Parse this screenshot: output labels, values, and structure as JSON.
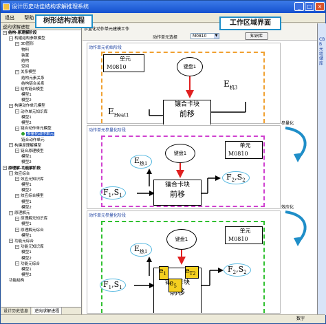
{
  "window": {
    "title": "设计历史动佳结构求解推理系统"
  },
  "menu": [
    "退出",
    "帮助"
  ],
  "left_pane": {
    "header": "逆向求解进程",
    "tree": [
      {
        "label": "结构-原理解阶段",
        "level": 0,
        "toggle": "−"
      },
      {
        "label": "构建结构参数模型",
        "level": 1,
        "toggle": "−"
      },
      {
        "label": "3D图形",
        "level": 2,
        "toggle": "−"
      },
      {
        "label": "物料",
        "level": 3
      },
      {
        "label": "装置",
        "level": 3
      },
      {
        "label": "结构",
        "level": 3
      },
      {
        "label": "空间",
        "level": 3
      },
      {
        "label": "关系模型",
        "level": 2,
        "toggle": "−"
      },
      {
        "label": "结构元素关系",
        "level": 3
      },
      {
        "label": "结构链合关系",
        "level": 3
      },
      {
        "label": "结构链合模型",
        "level": 2,
        "toggle": "−"
      },
      {
        "label": "模型1",
        "level": 3
      },
      {
        "label": "模型2",
        "level": 3
      },
      {
        "label": "构建动作单元模型",
        "level": 1,
        "toggle": "−"
      },
      {
        "label": "动作单元知识库",
        "level": 2,
        "toggle": "−"
      },
      {
        "label": "模型1",
        "level": 3
      },
      {
        "label": "模型2",
        "level": 3
      },
      {
        "label": "链合动作单元模型",
        "level": 2,
        "toggle": "−"
      },
      {
        "label": "参量化动作单元",
        "level": 3,
        "selected": true
      },
      {
        "label": "链合动作单元",
        "level": 3
      },
      {
        "label": "构建原理解模型",
        "level": 1,
        "toggle": "−"
      },
      {
        "label": "链合原理模型",
        "level": 2,
        "toggle": "−"
      },
      {
        "label": "模型1",
        "level": 3
      },
      {
        "label": "模型2",
        "level": 3
      },
      {
        "label": "原理解-功能解阶段",
        "level": 0,
        "toggle": "−"
      },
      {
        "label": "效应综合",
        "level": 1,
        "toggle": "−"
      },
      {
        "label": "效应元知识库",
        "level": 2,
        "toggle": "−"
      },
      {
        "label": "模型1",
        "level": 3
      },
      {
        "label": "模型2",
        "level": 3
      },
      {
        "label": "效应综合模型",
        "level": 2,
        "toggle": "−"
      },
      {
        "label": "模型1",
        "level": 3
      },
      {
        "label": "模型2",
        "level": 3
      },
      {
        "label": "原理解元",
        "level": 1,
        "toggle": "−"
      },
      {
        "label": "原理解元知识库",
        "level": 2,
        "toggle": "−"
      },
      {
        "label": "模型1",
        "level": 3
      },
      {
        "label": "原理解元综合",
        "level": 2,
        "toggle": "−"
      },
      {
        "label": "模型1",
        "level": 3
      },
      {
        "label": "功能元综合",
        "level": 1,
        "toggle": "−"
      },
      {
        "label": "功能元知识库",
        "level": 2,
        "toggle": "−"
      },
      {
        "label": "模型1",
        "level": 3
      },
      {
        "label": "模型2",
        "level": 3
      },
      {
        "label": "功能元综合",
        "level": 2,
        "toggle": "−"
      },
      {
        "label": "模型1",
        "level": 3
      },
      {
        "label": "模型2",
        "level": 3
      },
      {
        "label": "功能结构",
        "level": 1
      }
    ],
    "tabs": [
      "设计历史信息",
      "逆向求解进程"
    ]
  },
  "main_pane": {
    "panel_title": "参量化动作单元建模工作",
    "selector_label": "动作单元选择",
    "selector_value": "M0810",
    "kb_button": "知识库",
    "sections": [
      {
        "title": "动作单元初始阶段",
        "unit_label": "单元",
        "unit_code": "M0810",
        "circle": "键盘1",
        "block_line1": "镶合卡块",
        "block_line2": "前移",
        "e_right": "E",
        "e_right_sub": "机3",
        "e_left": "E",
        "e_left_sub": "Heat1",
        "dash_color": "#f0a030"
      },
      {
        "title": "动作单元参量化阶段",
        "unit_label": "单元",
        "unit_code": "M0810",
        "circle": "键盘1",
        "block_line1": "镶合卡块",
        "block_line2": "前移",
        "e_left": "E",
        "e_left_sub": "热1",
        "f_left": "F",
        "f_left_sub": "1",
        "s_left": "S",
        "s_left_sub": "1",
        "f_right": "F",
        "f_right_sub": "2",
        "s_right": "S",
        "s_right_sub": "2",
        "dash_color": "#d040d0"
      },
      {
        "title": "动作单元参量化阶段",
        "unit_label": "单元",
        "unit_code": "M0810",
        "circle": "键盘1",
        "block_line1": "镶合卡块",
        "block_line2": "前移",
        "e_left": "E",
        "e_left_sub": "热1",
        "f_left": "F",
        "f_left_sub": "1",
        "s_left": "S",
        "s_left_sub": "1",
        "f_right": "F",
        "f_right_sub": "2",
        "s_right": "S",
        "s_right_sub": "2",
        "e1": "e",
        "e1_sub": "1",
        "e5": "e",
        "e5_sub": "5",
        "et2": "e",
        "et2_sub": "T2",
        "dash_color": "#30c030"
      }
    ],
    "side_labels": [
      "参量化",
      "效应化"
    ]
  },
  "callouts": {
    "tree": "树形结构流程",
    "workspace": "工作区域界面"
  },
  "right_pane": {
    "label": "CBB元组储库"
  },
  "status": {
    "kb": "数字"
  },
  "colors": {
    "title_blue": "#1551cf",
    "accent_cyan": "#1f8ec8",
    "red_arrow": "#e02020"
  }
}
